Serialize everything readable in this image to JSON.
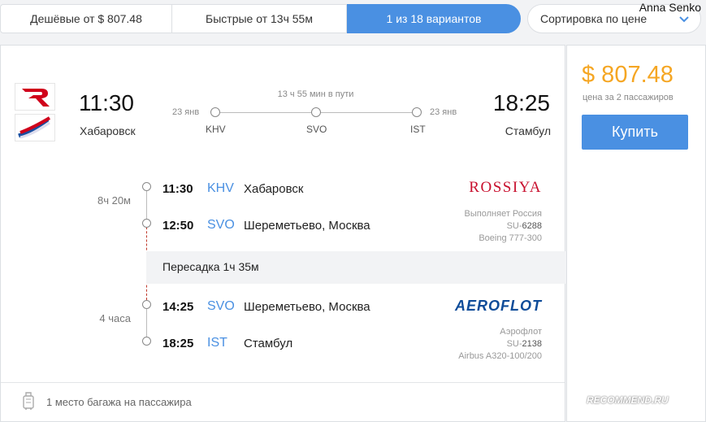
{
  "tabs": [
    {
      "label": "Дешёвые от $ 807.48"
    },
    {
      "label": "Быстрые от 13ч 55м"
    },
    {
      "label": "1 из 18 вариантов"
    }
  ],
  "sort": {
    "label": "Сортировка по цене"
  },
  "user": {
    "name": "Anna Senko"
  },
  "flight": {
    "dep_time": "11:30",
    "dep_city": "Хабаровск",
    "arr_time": "18:25",
    "arr_city": "Стамбул",
    "total_duration": "13 ч 55 мин в пути",
    "dep_date": "23 янв",
    "arr_date": "23 янв",
    "route_codes": [
      "KHV",
      "SVO",
      "IST"
    ]
  },
  "segments": [
    {
      "duration": "8ч 20м",
      "from": {
        "time": "11:30",
        "code": "KHV",
        "name": "Хабаровск"
      },
      "to": {
        "time": "12:50",
        "code": "SVO",
        "name": "Шереметьево, Москва"
      },
      "airline_brand": "ROSSIYA",
      "operator": "Выполняет Россия",
      "flight_prefix": "SU-",
      "flight_no": "6288",
      "aircraft": "Boeing 777-300"
    },
    {
      "duration": "4 часа",
      "from": {
        "time": "14:25",
        "code": "SVO",
        "name": "Шереметьево, Москва"
      },
      "to": {
        "time": "18:25",
        "code": "IST",
        "name": "Стамбул"
      },
      "airline_brand": "AEROFLOT",
      "operator": "Аэрофлот",
      "flight_prefix": "SU-",
      "flight_no": "2138",
      "aircraft": "Airbus A320-100/200"
    }
  ],
  "transfer": {
    "label": "Пересадка 1ч 35м"
  },
  "baggage": {
    "label": "1 место багажа на пассажира"
  },
  "price": {
    "value": "$ 807.48",
    "note": "цена за 2 пассажиров",
    "buy_label": "Купить"
  },
  "watermark": {
    "text": "RECOMMEND.RU"
  },
  "colors": {
    "accent": "#4a90e2",
    "price": "#f5a623",
    "rossiya": "#c8102e",
    "aeroflot": "#0f4c99"
  }
}
